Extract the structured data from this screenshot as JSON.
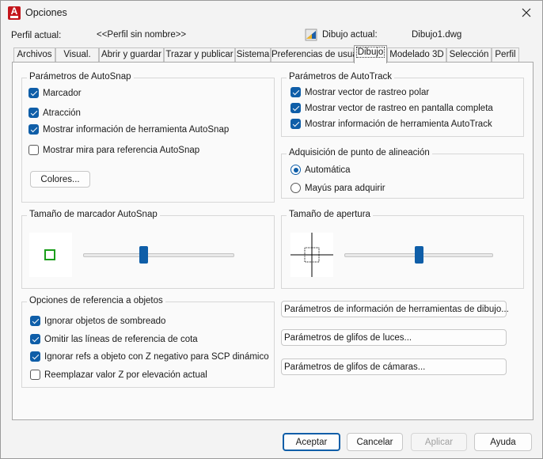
{
  "window": {
    "title": "Opciones"
  },
  "profile": {
    "label": "Perfil actual:",
    "value": "<<Perfil sin nombre>>",
    "drawing_label": "Dibujo actual:",
    "drawing_value": "Dibujo1.dwg"
  },
  "tabs": [
    "Archivos",
    "Visual.",
    "Abrir y guardar",
    "Trazar y publicar",
    "Sistema",
    "Preferencias de usuario",
    "Dibujo",
    "Modelado 3D",
    "Selección",
    "Perfil"
  ],
  "active_tab": "Dibujo",
  "autosnap": {
    "title": "Parámetros de AutoSnap",
    "marker": {
      "label": "Marcador",
      "checked": true
    },
    "magnet": {
      "label": "Atracción",
      "checked": true
    },
    "tooltip": {
      "label": "Mostrar información de herramienta AutoSnap",
      "checked": true
    },
    "aperture": {
      "label": "Mostrar mira para referencia AutoSnap",
      "checked": false
    },
    "colors_button": "Colores..."
  },
  "autotrack": {
    "title": "Parámetros de AutoTrack",
    "polar": {
      "label": "Mostrar vector de rastreo polar",
      "checked": true
    },
    "fullscreen": {
      "label": "Mostrar vector de rastreo en pantalla completa",
      "checked": true
    },
    "tooltip": {
      "label": "Mostrar información de herramienta AutoTrack",
      "checked": true
    }
  },
  "alignment": {
    "title": "Adquisición de punto de alineación",
    "automatic": {
      "label": "Automática",
      "selected": true
    },
    "shift": {
      "label": "Mayús para adquirir",
      "selected": false
    }
  },
  "marker_size": {
    "title": "Tamaño de marcador AutoSnap",
    "level": 0.4
  },
  "aperture_size": {
    "title": "Tamaño de apertura",
    "level": 0.5
  },
  "osnap": {
    "title": "Opciones de referencia a objetos",
    "ignore_hatch": {
      "label": "Ignorar objetos de sombreado",
      "checked": true
    },
    "omit_dims": {
      "label": "Omitir las líneas de referencia de cota",
      "checked": true
    },
    "ignore_negz": {
      "label": "Ignorar refs a objeto con Z negativo para SCP dinámico",
      "checked": true
    },
    "replace_z": {
      "label": "Reemplazar valor Z por elevación actual",
      "checked": false
    }
  },
  "side_buttons": {
    "drafting_tooltip": "Parámetros de información de herramientas de dibujo...",
    "lights_glyph": "Parámetros de glifos de luces...",
    "cameras_glyph": "Parámetros de glifos de cámaras..."
  },
  "footer": {
    "ok": "Aceptar",
    "cancel": "Cancelar",
    "apply": "Aplicar",
    "help": "Ayuda"
  },
  "colors": {
    "accent": "#0f5ea8",
    "marker_green": "#1a9e1a",
    "app_red": "#c4161c"
  }
}
